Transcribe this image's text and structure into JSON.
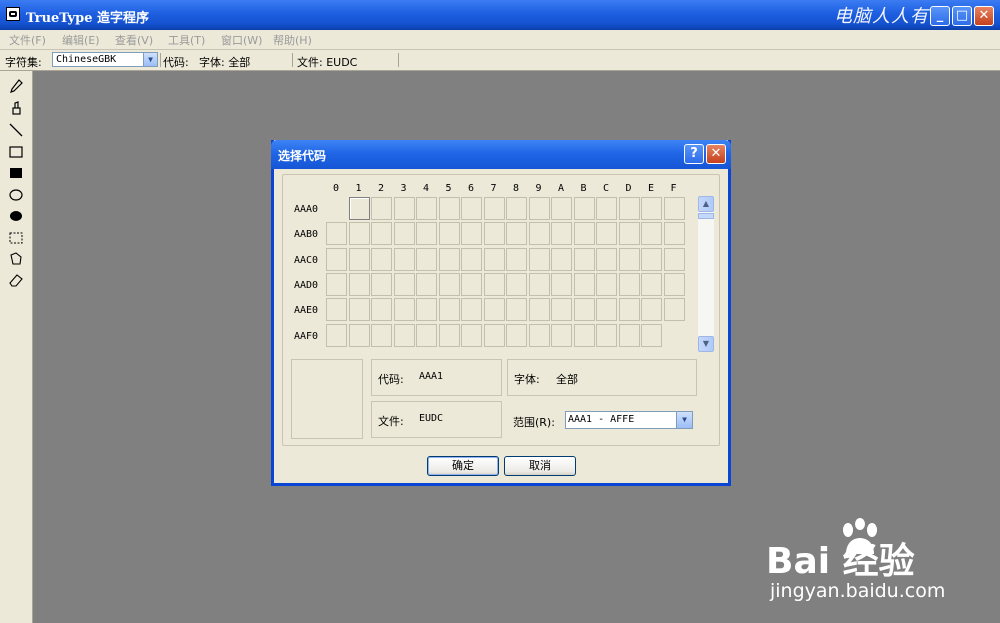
{
  "window": {
    "title": "TrueType 造字程序",
    "watermark": "电脑人人有",
    "controls": {
      "minimize": "_",
      "maximize": "□",
      "close": "✕"
    }
  },
  "menu": [
    "文件(F)",
    "编辑(E)",
    "查看(V)",
    "工具(T)",
    "窗口(W)",
    "帮助(H)"
  ],
  "toolbar": {
    "charset_label": "字符集:",
    "charset_value": "ChineseGBK",
    "code_label": "代码:",
    "font_label": "字体: 全部",
    "file_label": "文件: EUDC"
  },
  "tools": [
    "pencil-icon",
    "brush-icon",
    "line-icon",
    "rectangle-outline-icon",
    "rectangle-filled-icon",
    "ellipse-outline-icon",
    "ellipse-filled-icon",
    "rect-select-icon",
    "freeform-select-icon",
    "eraser-icon"
  ],
  "dialog": {
    "title": "选择代码",
    "help": "?",
    "close": "✕",
    "columns": [
      "0",
      "1",
      "2",
      "3",
      "4",
      "5",
      "6",
      "7",
      "8",
      "9",
      "A",
      "B",
      "C",
      "D",
      "E",
      "F"
    ],
    "rows": [
      "AAA0",
      "AAB0",
      "AAC0",
      "AAD0",
      "AAE0",
      "AAF0"
    ],
    "code_label": "代码:",
    "code_value": "AAA1",
    "font_label": "字体:",
    "font_value": "全部",
    "file_label": "文件:",
    "file_value": "EUDC",
    "range_label": "范围(R):",
    "range_value": "AAA1 - AFFE",
    "ok": "确定",
    "cancel": "取消"
  },
  "baidu_watermark": {
    "main": "Bai  经验",
    "sub": "jingyan.baidu.com"
  }
}
